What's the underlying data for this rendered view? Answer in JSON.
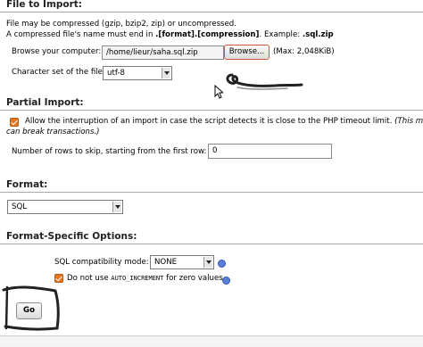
{
  "file_import": {
    "title": "File to Import:",
    "compress_note": "File may be compressed (gzip, bzip2, zip) or uncompressed.",
    "name_note_prefix": "A compressed file's name must end in ",
    "name_note_format": ".[format].[compression]",
    "name_note_example": ". Example: ",
    "name_note_ext": ".sql.zip",
    "browse_label": "Browse your computer:",
    "file_path": "/home/lieur/saha.sql.zip",
    "browse_button": "Browse...",
    "max_size": "(Max: 2,048KiB)",
    "charset_label": "Character set of the file:",
    "charset_value": "utf-8"
  },
  "partial_import": {
    "title": "Partial Import:",
    "allow_interrupt_label": "Allow the interruption of an import in case the script detects it is close to the PHP timeout limit.",
    "allow_interrupt_note": "(This mig",
    "allow_interrupt_note_line2": "can break transactions.)",
    "allow_interrupt_checked": true,
    "skip_rows_label": "Number of rows to skip, starting from the first row:",
    "skip_rows_value": "0"
  },
  "format": {
    "title": "Format:",
    "value": "SQL"
  },
  "format_options": {
    "title": "Format-Specific Options:",
    "compat_label": "SQL compatibility mode:",
    "compat_value": "NONE",
    "auto_inc_prefix": "Do not use ",
    "auto_inc_code": "AUTO_INCREMENT",
    "auto_inc_suffix": " for zero values",
    "auto_inc_checked": true
  },
  "go_button": "Go",
  "colors": {
    "checkbox": "#e8761f",
    "help_icon": "#5b7fd6",
    "annotation": "#222222"
  }
}
